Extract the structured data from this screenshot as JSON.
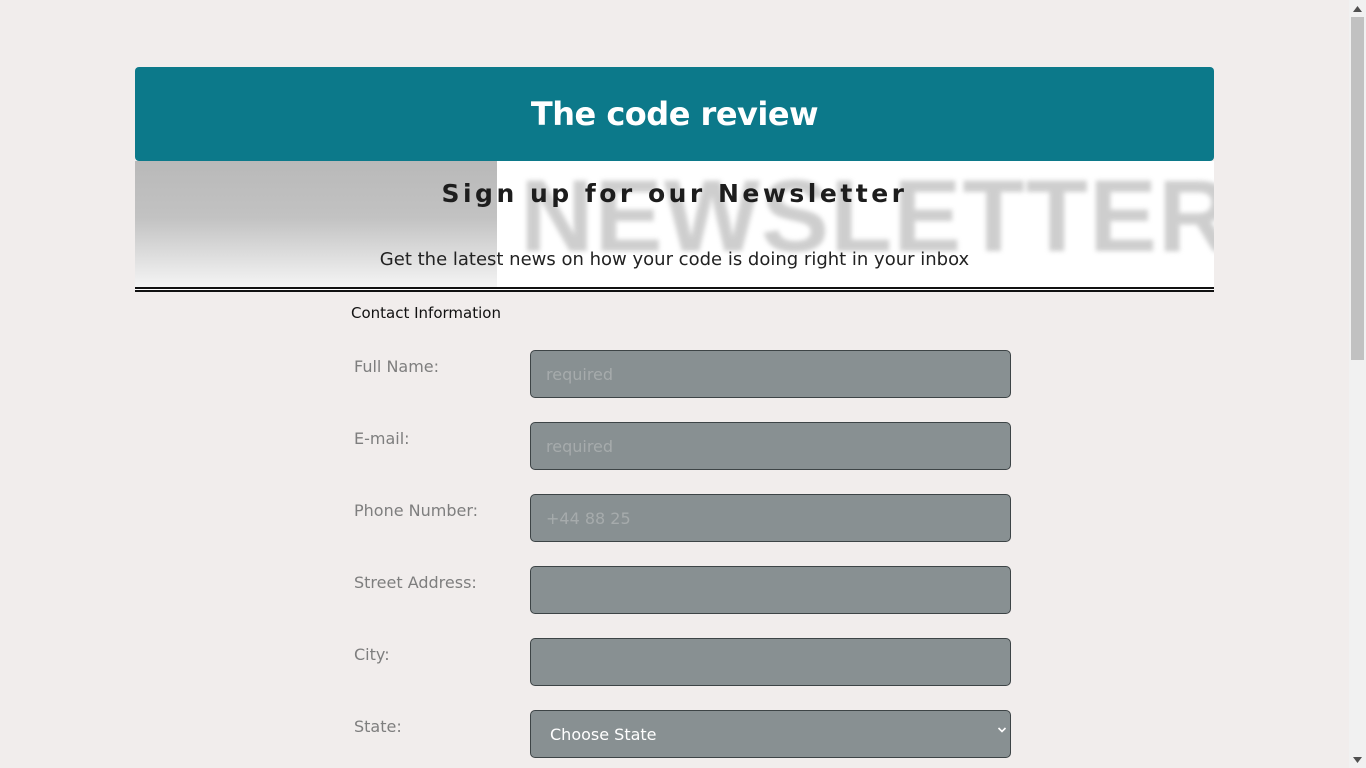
{
  "header": {
    "title": "The code review"
  },
  "banner": {
    "heading": "Sign up for our Newsletter",
    "image_word": "NEWSLETTER",
    "subtext": "Get the latest news on how your code is doing right in your inbox"
  },
  "form": {
    "legend": "Contact Information",
    "fields": {
      "full_name": {
        "label": "Full Name:",
        "placeholder": "required",
        "value": ""
      },
      "email": {
        "label": "E-mail:",
        "placeholder": "required",
        "value": ""
      },
      "phone": {
        "label": "Phone Number:",
        "placeholder": "+44 88 25",
        "value": ""
      },
      "street": {
        "label": "Street Address:",
        "placeholder": "",
        "value": ""
      },
      "city": {
        "label": "City:",
        "placeholder": "",
        "value": ""
      },
      "state": {
        "label": "State:",
        "selected": "Choose State"
      }
    }
  },
  "icons": {
    "select_arrow": "chevron-down-icon",
    "scroll_up": "triangle-up-icon",
    "scroll_down": "triangle-down-icon"
  },
  "colors": {
    "header_bg": "#0c798a",
    "page_bg": "#f1edec",
    "input_bg": "#889092"
  }
}
